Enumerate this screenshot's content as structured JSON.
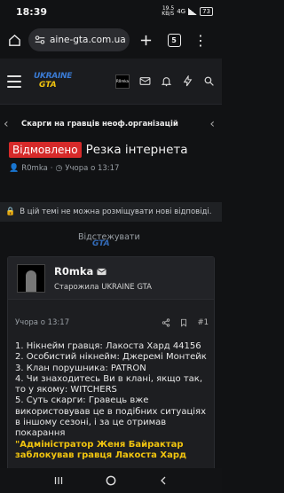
{
  "status": {
    "time": "18:39",
    "net_speed": "19.5",
    "net_unit": "KB/S",
    "network": "4G",
    "battery": "73"
  },
  "browser": {
    "url": "aine-gta.com.ua",
    "tabs_count": "5"
  },
  "header": {
    "logo_line1": "UKRAINE",
    "logo_line2": "GTA",
    "avatar_label": "R0mka"
  },
  "breadcrumb": {
    "label": "Скарги на гравців неоф.організацій"
  },
  "thread": {
    "badge": "Відмовлено",
    "title": "Резка інтернета",
    "author": "R0mka",
    "date": "Учора о 13:17"
  },
  "notice": {
    "text": "В цій темі не можна розміщувати нові відповіді."
  },
  "watch": {
    "label": "Відстежувати"
  },
  "post": {
    "author_name": "R0mka",
    "author_role": "Старожила UKRAINE GTA",
    "date": "Учора о 13:17",
    "number": "#1",
    "lines": [
      "1. Нікнейм гравця: Лакоста Хард 44156",
      "2. Особистий нікнейм: Джеремі Монтейк",
      "3. Клан порушника: PATRON",
      "4. Чи знаходитесь Ви в клані, якщо так, то у якому: WITCHERS",
      "5. Суть скарги: Гравець вже використовував це в подібних ситуаціях в іншому сезоні, і за це отримав покарання"
    ],
    "quote": "\"Адміністратор Женя Байрактар заблокував гравця Лакоста Хард"
  },
  "colors": {
    "badge_red": "#d62a2a",
    "quote_yellow": "#f1c40f",
    "logo_blue": "#3a7bd5",
    "background": "#111214"
  }
}
